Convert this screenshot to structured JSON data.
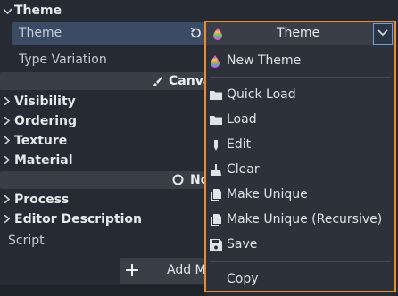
{
  "inspector": {
    "theme_section": "Theme",
    "theme_property": "Theme",
    "type_variation": "Type Variation",
    "canvas_button": "Canva",
    "sections": [
      "Visibility",
      "Ordering",
      "Texture",
      "Material"
    ],
    "node_button": "No",
    "process_section": "Process",
    "editor_description_section": "Editor Description",
    "script_label": "Script",
    "add_button": "Add M"
  },
  "popup": {
    "selected_value": "Theme",
    "items": {
      "new_theme": "New Theme",
      "quick_load": "Quick Load",
      "load": "Load",
      "edit": "Edit",
      "clear": "Clear",
      "make_unique": "Make Unique",
      "make_unique_recursive": "Make Unique (Recursive)",
      "save": "Save",
      "copy": "Copy"
    }
  },
  "colors": {
    "popup_border": "#f08a2e",
    "selected_row": "#3b4b63",
    "chevron_border": "#6a9fe0"
  },
  "icons": [
    "revert-icon",
    "theme-icon",
    "folder-icon",
    "edit-icon",
    "clear-icon",
    "duplicate-icon",
    "save-icon",
    "brush-icon",
    "circle-icon",
    "plus-icon",
    "chevron-down-icon"
  ]
}
